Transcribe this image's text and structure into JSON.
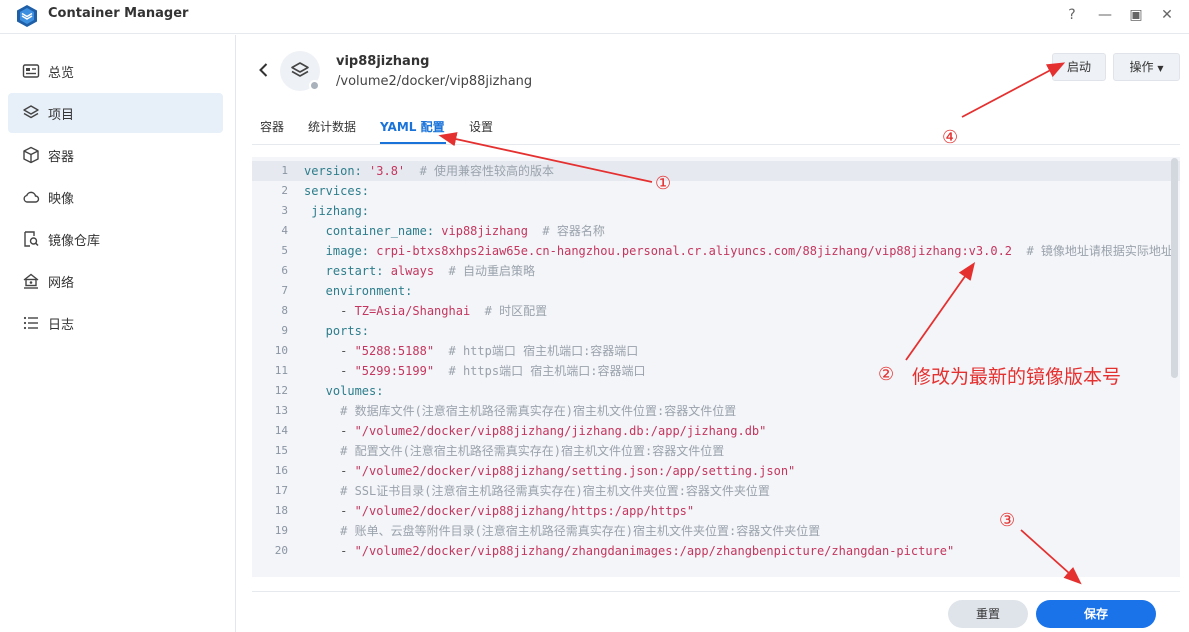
{
  "app": {
    "title": "Container Manager"
  },
  "window": {
    "help": "?",
    "minimize": "—",
    "maximize": "▣",
    "close": "✕"
  },
  "sidebar": {
    "items": [
      {
        "label": "总览",
        "icon": "overview-icon",
        "active": false
      },
      {
        "label": "项目",
        "icon": "project-layers-icon",
        "active": true
      },
      {
        "label": "容器",
        "icon": "container-cube-icon",
        "active": false
      },
      {
        "label": "映像",
        "icon": "image-cloud-icon",
        "active": false
      },
      {
        "label": "镜像仓库",
        "icon": "registry-search-icon",
        "active": false
      },
      {
        "label": "网络",
        "icon": "network-house-icon",
        "active": false
      },
      {
        "label": "日志",
        "icon": "log-list-icon",
        "active": false
      }
    ]
  },
  "project": {
    "name": "vip88jizhang",
    "path": "/volume2/docker/vip88jizhang"
  },
  "header": {
    "start_label": "启动",
    "actions_label": "操作"
  },
  "tabs": [
    {
      "label": "容器",
      "active": false
    },
    {
      "label": "统计数据",
      "active": false
    },
    {
      "label": "YAML 配置",
      "active": true
    },
    {
      "label": "设置",
      "active": false
    }
  ],
  "yaml": {
    "lines": [
      {
        "n": "1",
        "parts": [
          [
            "k",
            "version: "
          ],
          [
            "s",
            "'3.8'"
          ],
          [
            "c",
            "  # 使用兼容性较高的版本"
          ]
        ]
      },
      {
        "n": "2",
        "parts": [
          [
            "k",
            "services:"
          ]
        ]
      },
      {
        "n": "3",
        "parts": [
          [
            "k",
            " jizhang:"
          ]
        ]
      },
      {
        "n": "4",
        "parts": [
          [
            "k",
            "   container_name: "
          ],
          [
            "s",
            "vip88jizhang"
          ],
          [
            "c",
            "  # 容器名称"
          ]
        ]
      },
      {
        "n": "5",
        "parts": [
          [
            "k",
            "   image: "
          ],
          [
            "s",
            "crpi-btxs8xhps2iaw65e.cn-hangzhou.personal.cr.aliyuncs.com/88jizhang/vip88jizhang:v3.0.2"
          ],
          [
            "c",
            "  # 镜像地址请根据实际地址"
          ]
        ]
      },
      {
        "n": "6",
        "parts": [
          [
            "k",
            "   restart: "
          ],
          [
            "s",
            "always"
          ],
          [
            "c",
            "  # 自动重启策略"
          ]
        ]
      },
      {
        "n": "7",
        "parts": [
          [
            "k",
            "   environment:"
          ]
        ]
      },
      {
        "n": "8",
        "parts": [
          [
            "p",
            "     - "
          ],
          [
            "s",
            "TZ=Asia/Shanghai"
          ],
          [
            "c",
            "  # 时区配置"
          ]
        ]
      },
      {
        "n": "9",
        "parts": [
          [
            "k",
            "   ports:"
          ]
        ]
      },
      {
        "n": "10",
        "parts": [
          [
            "p",
            "     - "
          ],
          [
            "s",
            "\"5288:5188\""
          ],
          [
            "c",
            "  # http端口 宿主机端口:容器端口"
          ]
        ]
      },
      {
        "n": "11",
        "parts": [
          [
            "p",
            "     - "
          ],
          [
            "s",
            "\"5299:5199\""
          ],
          [
            "c",
            "  # https端口 宿主机端口:容器端口"
          ]
        ]
      },
      {
        "n": "12",
        "parts": [
          [
            "k",
            "   volumes:"
          ]
        ]
      },
      {
        "n": "13",
        "parts": [
          [
            "c",
            "     # 数据库文件(注意宿主机路径需真实存在)宿主机文件位置:容器文件位置"
          ]
        ]
      },
      {
        "n": "14",
        "parts": [
          [
            "p",
            "     - "
          ],
          [
            "s",
            "\"/volume2/docker/vip88jizhang/jizhang.db:/app/jizhang.db\""
          ]
        ]
      },
      {
        "n": "15",
        "parts": [
          [
            "c",
            "     # 配置文件(注意宿主机路径需真实存在)宿主机文件位置:容器文件位置"
          ]
        ]
      },
      {
        "n": "16",
        "parts": [
          [
            "p",
            "     - "
          ],
          [
            "s",
            "\"/volume2/docker/vip88jizhang/setting.json:/app/setting.json\""
          ]
        ]
      },
      {
        "n": "17",
        "parts": [
          [
            "c",
            "     # SSL证书目录(注意宿主机路径需真实存在)宿主机文件夹位置:容器文件夹位置"
          ]
        ]
      },
      {
        "n": "18",
        "parts": [
          [
            "p",
            "     - "
          ],
          [
            "s",
            "\"/volume2/docker/vip88jizhang/https:/app/https\""
          ]
        ]
      },
      {
        "n": "19",
        "parts": [
          [
            "c",
            "     # 账单、云盘等附件目录(注意宿主机路径需真实存在)宿主机文件夹位置:容器文件夹位置"
          ]
        ]
      },
      {
        "n": "20",
        "parts": [
          [
            "p",
            "     - "
          ],
          [
            "s",
            "\"/volume2/docker/vip88jizhang/zhangdanimages:/app/zhangbenpicture/zhangdan-picture\""
          ]
        ]
      }
    ]
  },
  "footer": {
    "reset_label": "重置",
    "save_label": "保存"
  },
  "annotations": {
    "n1": "①",
    "n2": "②",
    "n3": "③",
    "n4": "④",
    "note2": "修改为最新的镜像版本号",
    "color": "#e53030"
  }
}
